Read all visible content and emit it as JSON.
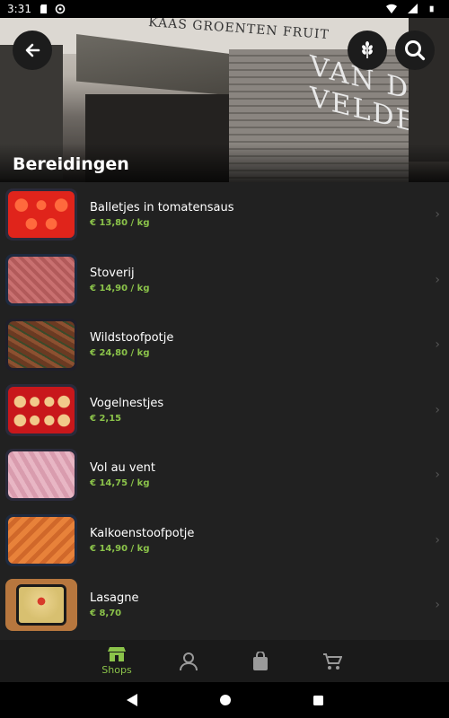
{
  "status_bar": {
    "time": "3:31"
  },
  "header": {
    "title": "Bereidingen",
    "sign_text": "KAAS  GROENTEN  FRUIT",
    "brand_text": "VAN DE VELDE"
  },
  "items": [
    {
      "name": "Balletjes in tomatensaus",
      "price": "€ 13,80 / kg"
    },
    {
      "name": "Stoverij",
      "price": "€ 14,90 / kg"
    },
    {
      "name": "Wildstoofpotje",
      "price": "€ 24,80 / kg"
    },
    {
      "name": "Vogelnestjes",
      "price": "€ 2,15"
    },
    {
      "name": "Vol au vent",
      "price": "€ 14,75 / kg"
    },
    {
      "name": "Kalkoenstoofpotje",
      "price": "€ 14,90 / kg"
    },
    {
      "name": "Lasagne",
      "price": "€ 8,70"
    }
  ],
  "bottom_nav": {
    "shops_label": "Shops"
  },
  "colors": {
    "accent": "#8bc34a",
    "background": "#212121"
  }
}
